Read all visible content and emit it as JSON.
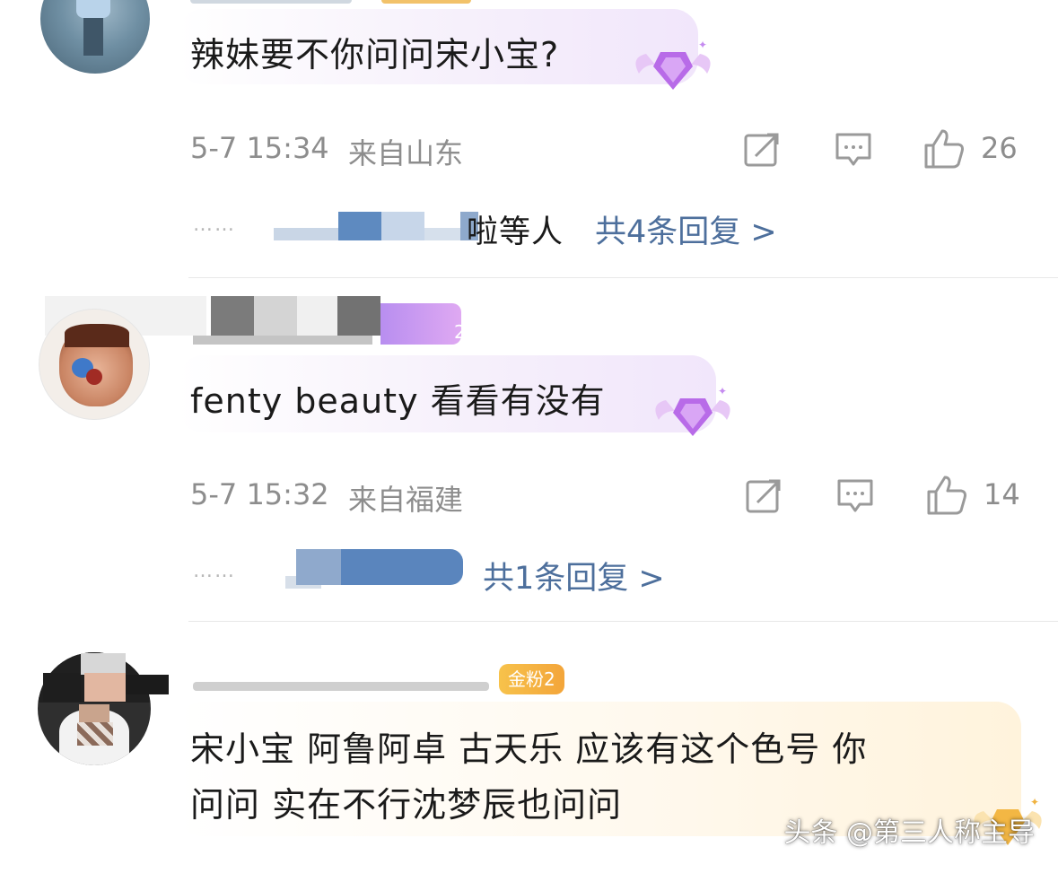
{
  "comments": [
    {
      "text": "辣妹要不你问问宋小宝?",
      "time": "5-7 15:34",
      "location": "来自山东",
      "likes": "26",
      "reply_names_suffix": "啦等人",
      "reply_link": "共4条回复 >"
    },
    {
      "text": "fenty beauty 看看有没有",
      "time": "5-7 15:32",
      "location": "来自福建",
      "likes": "14",
      "badge_level": "2",
      "reply_link": "共1条回复 >"
    },
    {
      "text_line1": "宋小宝  阿鲁阿卓  古天乐 应该有这个色号  你",
      "text_line2": "问问 实在不行沈梦辰也问问",
      "badge": "金粉2"
    }
  ],
  "reply_dots": "……",
  "watermark": "头条 @第三人称主导",
  "colors": {
    "reply_link": "#4d6f9c",
    "meta_text": "#8d8d8d",
    "gold_badge": "#f3a53a",
    "purple_badge": "#b45fe0"
  }
}
